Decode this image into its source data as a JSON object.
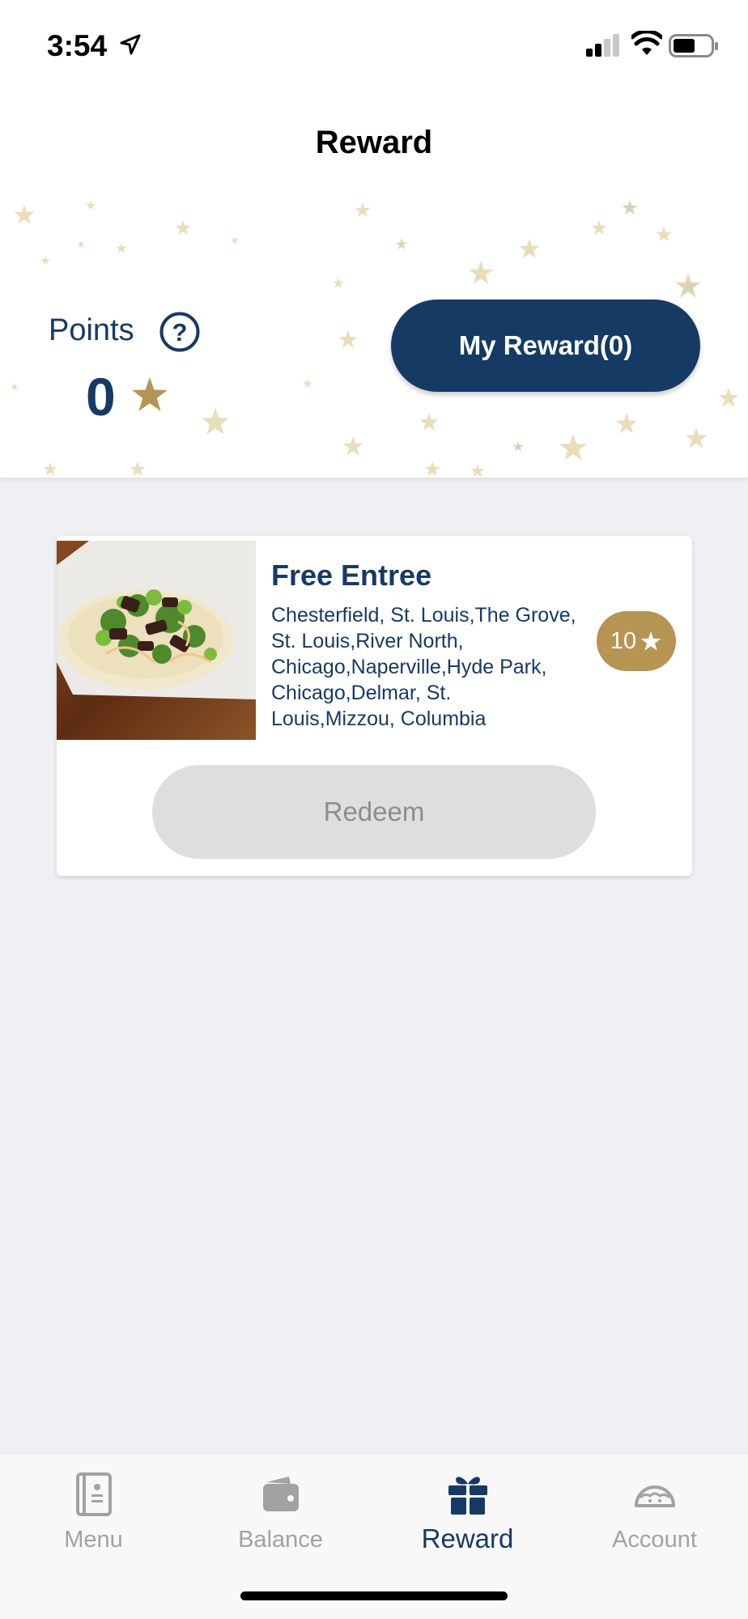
{
  "status_bar": {
    "time": "3:54"
  },
  "header": {
    "title": "Reward"
  },
  "points": {
    "label": "Points",
    "value": "0"
  },
  "my_reward_button": {
    "label": "My Reward(0)"
  },
  "reward_card": {
    "title": "Free Entree",
    "locations": "Chesterfield, St. Louis,The Grove, St. Louis,River North, Chicago,Naperville,Hyde Park, Chicago,Delmar, St. Louis,Mizzou, Columbia",
    "cost": "10",
    "redeem_label": "Redeem"
  },
  "tab_bar": {
    "items": [
      {
        "label": "Menu",
        "icon": "menu-book-icon",
        "active": false
      },
      {
        "label": "Balance",
        "icon": "wallet-icon",
        "active": false
      },
      {
        "label": "Reward",
        "icon": "gift-icon",
        "active": true
      },
      {
        "label": "Account",
        "icon": "taco-icon",
        "active": false
      }
    ]
  },
  "colors": {
    "brand_navy": "#153a63",
    "gold": "#b69451",
    "background": "#eff0f3",
    "inactive_tab": "#a2a2a2"
  }
}
